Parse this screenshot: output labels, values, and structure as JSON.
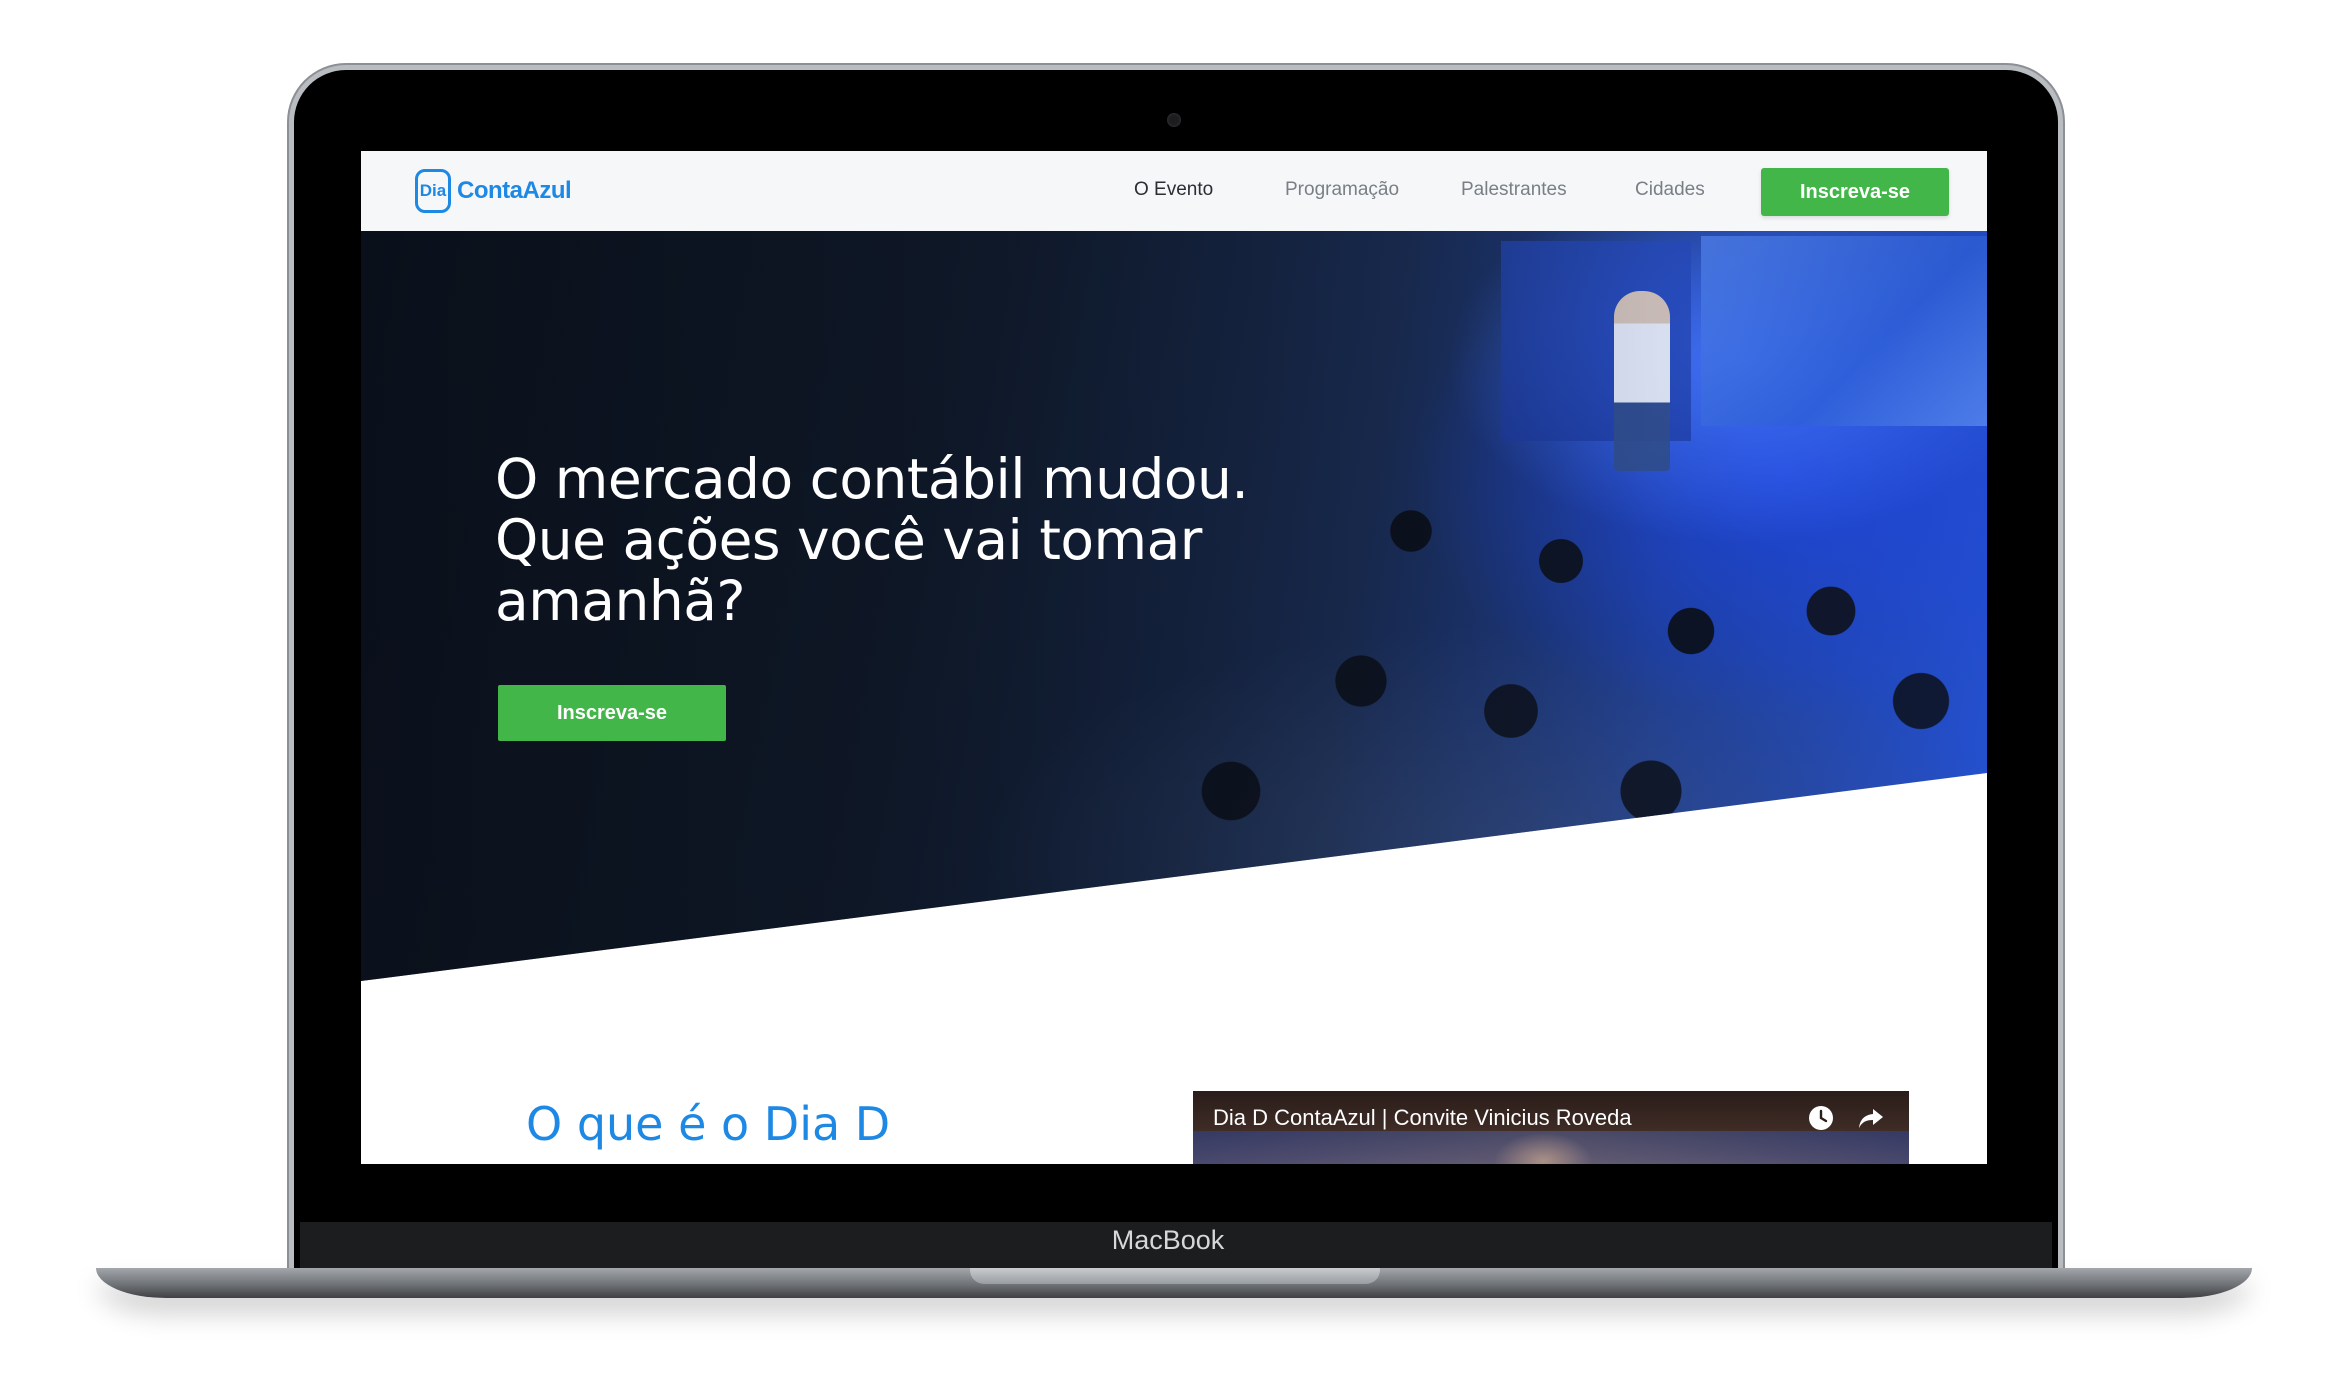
{
  "device": {
    "label": "MacBook"
  },
  "navbar": {
    "logo": {
      "mark": "Dia",
      "name": "ContaAzul"
    },
    "links": [
      {
        "label": "O Evento",
        "active": true
      },
      {
        "label": "Programação",
        "active": false
      },
      {
        "label": "Palestrantes",
        "active": false
      },
      {
        "label": "Cidades",
        "active": false
      }
    ],
    "cta_label": "Inscreva-se"
  },
  "hero": {
    "title_lines": [
      "O mercado contábil mudou.",
      "Que ações você vai tomar",
      "amanhã?"
    ],
    "cta_label": "Inscreva-se"
  },
  "about": {
    "title": "O que é o Dia D",
    "video": {
      "title": "Dia D ContaAzul | Convite Vinicius Roveda",
      "icons": [
        "clock-icon",
        "share-icon"
      ]
    }
  },
  "colors": {
    "brand_blue": "#1e88e5",
    "cta_green": "#43b649",
    "nav_bg": "#f5f7f9"
  }
}
